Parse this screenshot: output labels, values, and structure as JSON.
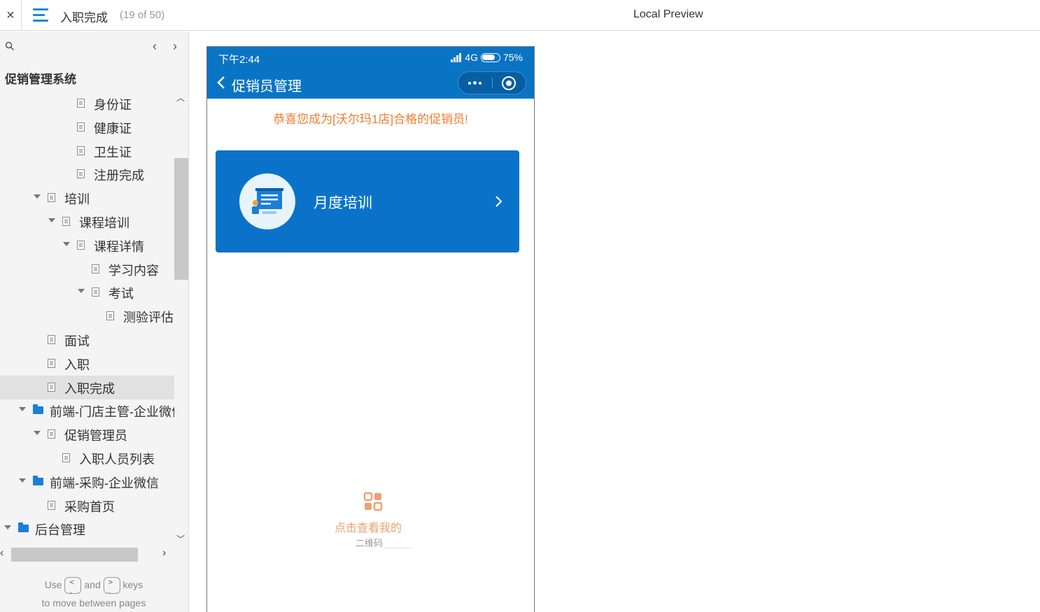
{
  "topbar": {
    "close_glyph": "×",
    "page_name": "入职完成",
    "page_count": "(19 of 50)",
    "preview_title": "Local Preview"
  },
  "sidebar": {
    "project_title": "促销管理系统",
    "prev_glyph": "‹",
    "next_glyph": "›",
    "items": [
      {
        "label": "身份证",
        "type": "page"
      },
      {
        "label": "健康证",
        "type": "page"
      },
      {
        "label": "卫生证",
        "type": "page"
      },
      {
        "label": "注册完成",
        "type": "page"
      },
      {
        "label": "培训",
        "type": "page",
        "expanded": true
      },
      {
        "label": "课程培训",
        "type": "page",
        "expanded": true
      },
      {
        "label": "课程详情",
        "type": "page",
        "expanded": true
      },
      {
        "label": "学习内容",
        "type": "page"
      },
      {
        "label": "考试",
        "type": "page",
        "expanded": true
      },
      {
        "label": "测验评估",
        "type": "page"
      },
      {
        "label": "面试",
        "type": "page"
      },
      {
        "label": "入职",
        "type": "page"
      },
      {
        "label": "入职完成",
        "type": "page",
        "selected": true
      },
      {
        "label": "前端-门店主管-企业微信",
        "type": "folder",
        "expanded": true
      },
      {
        "label": "促销管理员",
        "type": "page",
        "expanded": true
      },
      {
        "label": "入职人员列表",
        "type": "page"
      },
      {
        "label": "前端-采购-企业微信",
        "type": "folder",
        "expanded": true
      },
      {
        "label": "采购首页",
        "type": "page"
      },
      {
        "label": "后台管理",
        "type": "folder",
        "expanded": true
      }
    ],
    "hint": {
      "use": "Use",
      "and": "and",
      "keys": "keys",
      "key_prev": "<\n,",
      "key_next": ">\n.",
      "line2": "to move between pages"
    }
  },
  "phone": {
    "status_time": "下午2:44",
    "status_network": "4G",
    "status_battery": "75%",
    "battery_level": 0.75,
    "nav_title": "促销员管理",
    "congrats": "恭喜您成为[沃尔玛1店]合格的促销员!",
    "card_label": "月度培训",
    "qr_label": "点击查看我的",
    "qr_sub": "二维码"
  },
  "colors": {
    "brand_blue": "#0a74c4",
    "card_blue": "#0a73c9",
    "congrats_orange": "#f07d2e",
    "selected_bg": "#e1e1e1",
    "folder_blue": "#1a7fd6"
  }
}
